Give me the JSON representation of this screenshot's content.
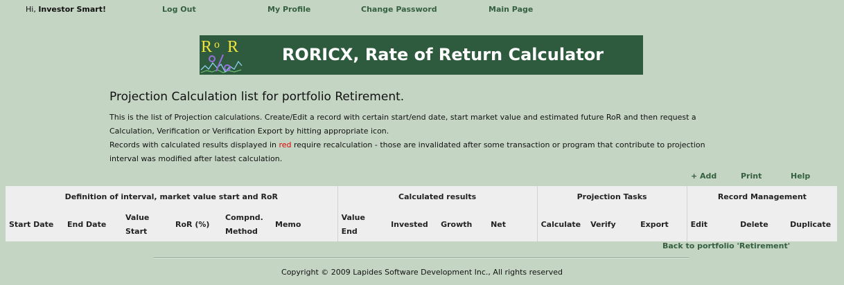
{
  "topnav": {
    "greeting_prefix": "Hi,",
    "user_name": "Investor Smart!",
    "links": {
      "logout": "Log Out",
      "profile": "My Profile",
      "change_password": "Change Password",
      "main_page": "Main Page"
    }
  },
  "banner": {
    "logo": {
      "letters": [
        "R",
        "o",
        "R"
      ]
    },
    "title": "RORICX, Rate of Return Calculator"
  },
  "page": {
    "heading": "Projection Calculation list for portfolio Retirement.",
    "intro": {
      "p1": "This is the list of Projection calculations. Create/Edit a record with certain start/end date, start market value and estimated future RoR and then request a Calculation, Verification or Verification Export by hitting appropriate icon.",
      "p2_before": "Records with calculated results displayed in ",
      "p2_highlight": "red",
      "p2_after": " require recalculation - those are invalidated after some transaction or program that contribute to projection interval was modified after latest calculation."
    }
  },
  "actions": {
    "add": "+ Add",
    "print": "Print",
    "help": "Help"
  },
  "table": {
    "groups": [
      "Definition of interval, market value start and RoR",
      "Calculated results",
      "Projection Tasks",
      "Record Management"
    ],
    "columns": [
      "Start Date",
      "End Date",
      "Value Start",
      "RoR (%)",
      "Compnd. Method",
      "Memo",
      "Value End",
      "Invested",
      "Growth",
      "Net",
      "Calculate",
      "Verify",
      "Export",
      "Edit",
      "Delete",
      "Duplicate"
    ]
  },
  "back_link": "Back to portfolio 'Retirement'",
  "footer": {
    "copyright": "Copyright © 2009 Lapides Software Development Inc., All rights reserved"
  },
  "colors": {
    "page_background": "#c4d5c3",
    "banner_background": "#2e5b3e",
    "banner_title": "#ffffff",
    "link": "#35603f",
    "highlight_red": "#e00000",
    "table_background": "#eeeeee",
    "table_divider": "#d3d3d3",
    "logo_letters": "#f2e33a",
    "logo_percent": "#9b6ee0"
  }
}
